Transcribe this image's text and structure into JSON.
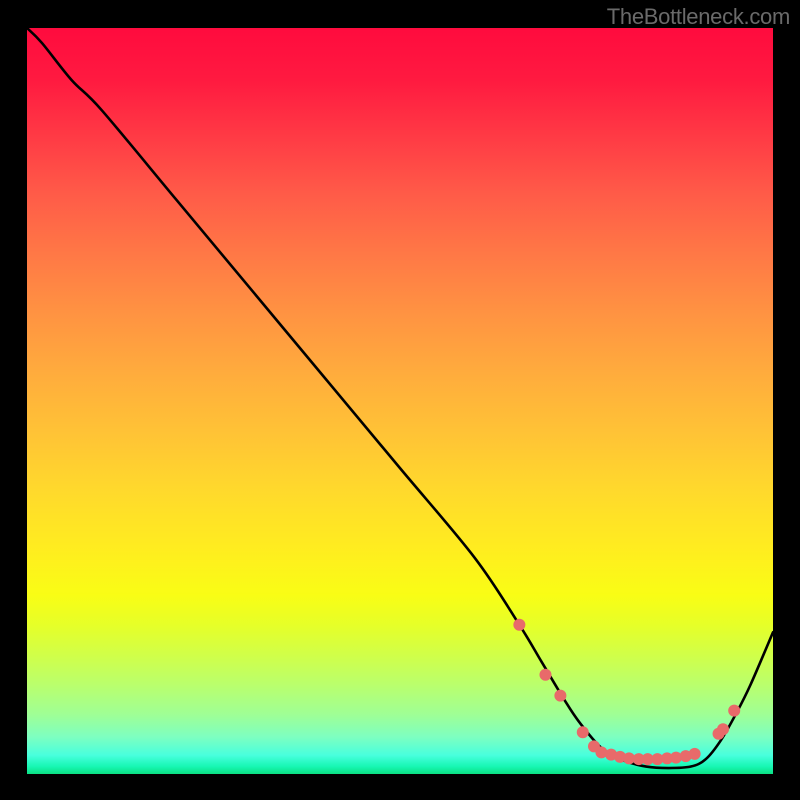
{
  "attribution": "TheBottleneck.com",
  "chart_data": {
    "type": "line",
    "title": "",
    "xlabel": "",
    "ylabel": "",
    "xlim": [
      0,
      100
    ],
    "ylim": [
      0,
      100
    ],
    "grid": false,
    "legend": false,
    "series": [
      {
        "name": "bottleneck-curve",
        "color": "#000000",
        "x": [
          0,
          2,
          6,
          10,
          20,
          30,
          40,
          50,
          60,
          66,
          69,
          72,
          74,
          77,
          80,
          83,
          86,
          89,
          91,
          93,
          95,
          97,
          100
        ],
        "y": [
          100,
          98,
          93,
          89,
          77,
          65,
          53,
          41,
          29,
          20,
          15,
          10,
          7,
          3.5,
          1.8,
          1,
          0.8,
          1,
          2,
          4.5,
          8,
          12,
          19
        ]
      }
    ],
    "markers": {
      "name": "optimal-points",
      "color": "#e86a6a",
      "radius_px": 6,
      "x": [
        66,
        69.5,
        71.5,
        74.5,
        76,
        77,
        78.3,
        79.5,
        80.7,
        82,
        83.2,
        84.5,
        85.8,
        87,
        88.3,
        89.5,
        92.7,
        93.3,
        94.8
      ],
      "y": [
        20,
        13.3,
        10.5,
        5.6,
        3.7,
        2.9,
        2.6,
        2.3,
        2.1,
        2.0,
        2.0,
        2.0,
        2.1,
        2.2,
        2.4,
        2.7,
        5.4,
        6.0,
        8.5
      ]
    },
    "gradient_stops": [
      {
        "pos": 0,
        "color": "#ff0b3e"
      },
      {
        "pos": 0.5,
        "color": "#ffc236"
      },
      {
        "pos": 0.78,
        "color": "#f0ff1d"
      },
      {
        "pos": 1.0,
        "color": "#0be083"
      }
    ]
  }
}
